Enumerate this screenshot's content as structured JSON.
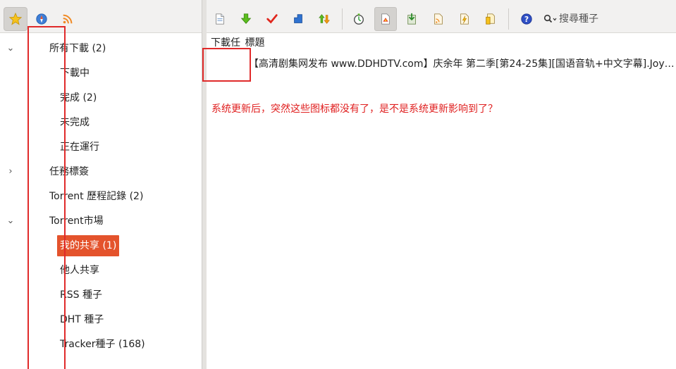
{
  "left_tabs": [
    {
      "icon": "star-icon",
      "active": true
    },
    {
      "icon": "compass-icon",
      "active": false
    },
    {
      "icon": "rss-icon",
      "active": false
    }
  ],
  "tree": {
    "all_downloads": "所有下載 (2)",
    "downloading": "下載中",
    "completed": "完成 (2)",
    "incomplete": "未完成",
    "running": "正在運行",
    "task_tags": "任務標簽",
    "torrent_history": "Torrent 歷程記錄 (2)",
    "torrent_market": "Torrent市場",
    "my_shares": "我的共享 (1)",
    "others_shares": "他人共享",
    "rss_seeds": "RSS 種子",
    "dht_seeds": "DHT 種子",
    "tracker_seeds": "Tracker種子 (168)"
  },
  "search": {
    "placeholder": "搜尋種子"
  },
  "table": {
    "col_task": "下載任",
    "col_title": "標題",
    "row_title": "【高清剧集网发布 www.DDHDTV.com】庆余年 第二季[第24-25集][国语音轨+中文字幕].Joy…"
  },
  "annotation": "系统更新后，突然这些图标都没有了，是不是系统更新影响到了？",
  "colors": {
    "accent": "#e4532c",
    "annotation_red": "#e02020"
  }
}
